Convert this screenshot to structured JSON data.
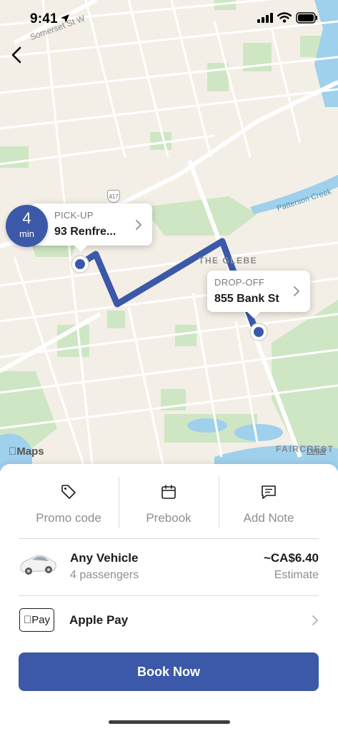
{
  "status_bar": {
    "time": "9:41"
  },
  "map": {
    "labels": {
      "somerset": "Somerset St W",
      "glebe": "THE GLEBE",
      "creek": "Patterson Creek",
      "faircrest": "FAIRCREST",
      "highway": "417"
    },
    "brand": "Maps",
    "legal": "Legal",
    "route_color": "#3b59a8"
  },
  "pickup": {
    "eta_value": "4",
    "eta_unit": "min",
    "label": "PICK-UP",
    "address": "93 Renfre..."
  },
  "dropoff": {
    "label": "DROP-OFF",
    "address": "855 Bank St"
  },
  "actions": [
    {
      "label": "Promo code",
      "icon": "tag-icon"
    },
    {
      "label": "Prebook",
      "icon": "calendar-icon"
    },
    {
      "label": "Add Note",
      "icon": "note-icon"
    }
  ],
  "vehicle": {
    "name": "Any Vehicle",
    "passengers": "4 passengers",
    "price": "~CA$6.40",
    "price_note": "Estimate"
  },
  "payment": {
    "badge": "Pay",
    "method": "Apple Pay"
  },
  "book_button": "Book Now",
  "colors": {
    "accent": "#3b59a8",
    "map_bg": "#f3efe6",
    "park": "#cfe6c4",
    "water": "#9fd0ec"
  }
}
